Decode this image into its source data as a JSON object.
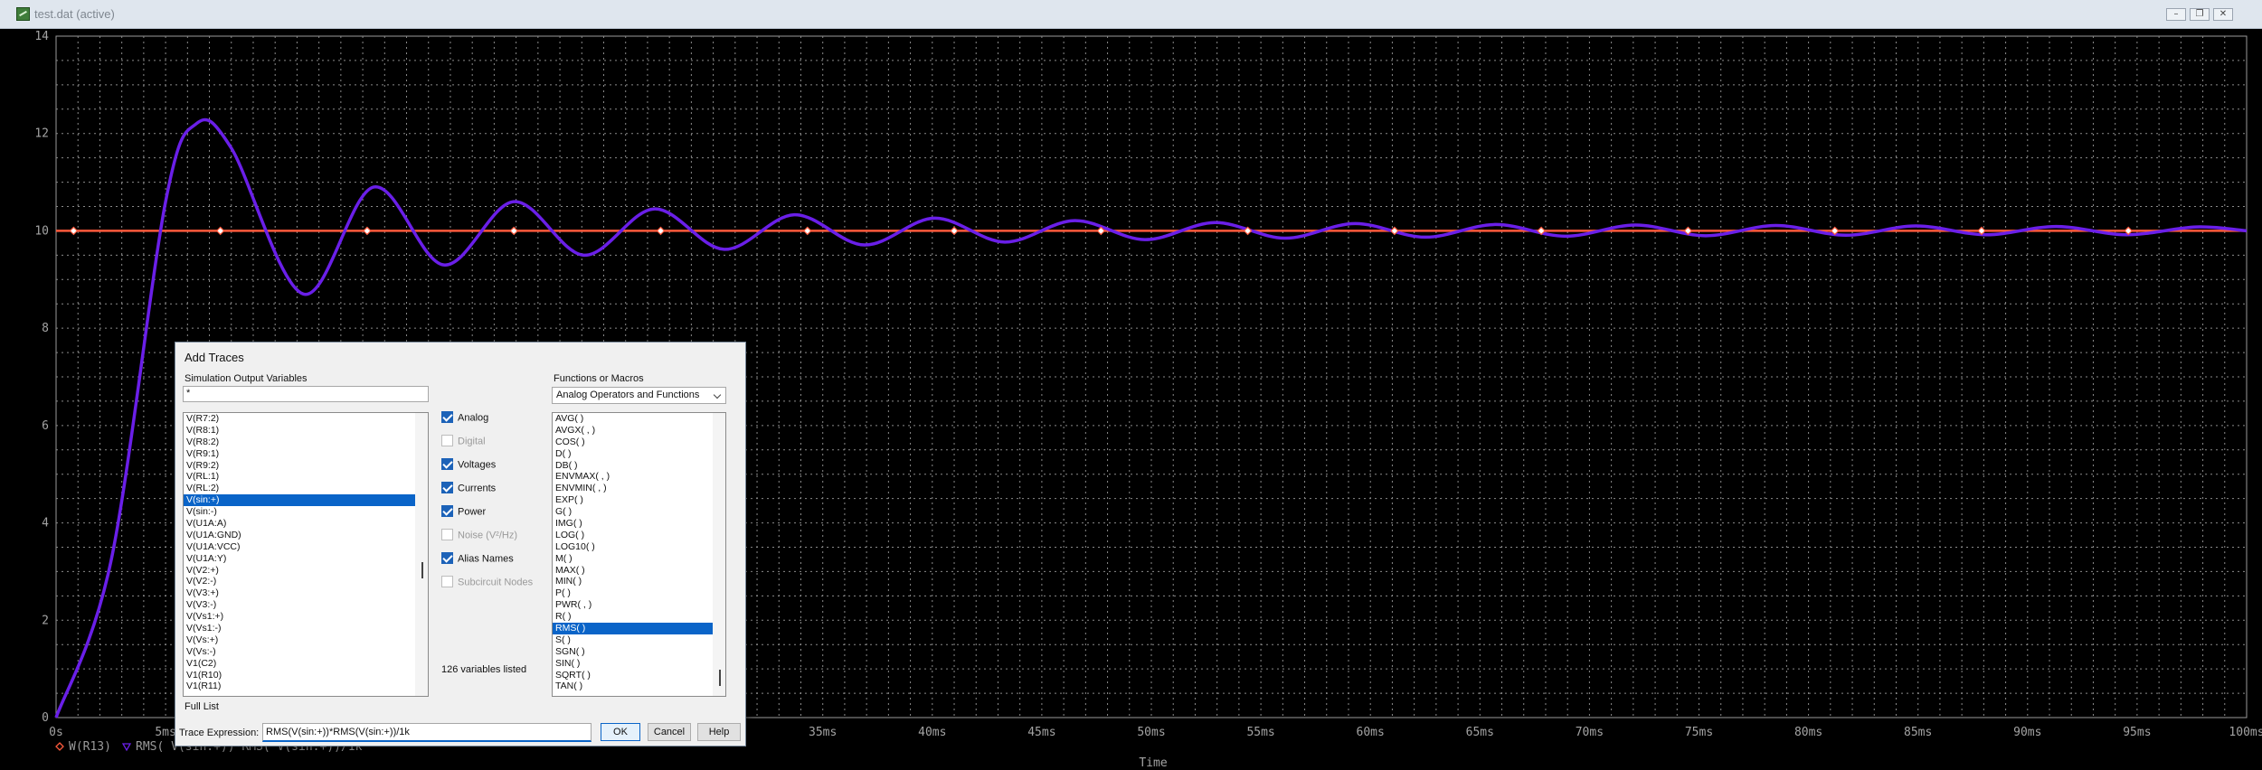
{
  "window": {
    "title": "test.dat (active)",
    "minimize_glyph": "–",
    "restore_glyph": "❐",
    "close_glyph": "✕",
    "icon": "waveform-app-icon"
  },
  "chart_data": {
    "type": "line",
    "title": "",
    "xlabel": "Time",
    "ylabel": "",
    "xlim": [
      0,
      100
    ],
    "ylim": [
      0,
      14
    ],
    "x_unit": "ms",
    "x_ticks": [
      "0s",
      "5ms",
      "10ms",
      "15ms",
      "20ms",
      "25ms",
      "30ms",
      "35ms",
      "40ms",
      "45ms",
      "50ms",
      "55ms",
      "60ms",
      "65ms",
      "70ms",
      "75ms",
      "80ms",
      "85ms",
      "90ms",
      "95ms",
      "100ms"
    ],
    "y_ticks": [
      "0",
      "2",
      "4",
      "6",
      "8",
      "10",
      "12",
      "14"
    ],
    "grid": true,
    "legend_placement": "bottom-left",
    "series": [
      {
        "name": "W(R13)",
        "color": "#ff5a3c",
        "marker": "diamond",
        "x": [
          0,
          100
        ],
        "values": [
          10,
          10
        ]
      },
      {
        "name": "RMS( V(sin:+))*RMS( V(sin:+))/1k",
        "color": "#6a1fe8",
        "marker": "triangle",
        "x": [
          0,
          2.5,
          5,
          6.4,
          8,
          11.3,
          14.5,
          17.7,
          20.9,
          24.1,
          27.3,
          30.5,
          33.7,
          36.9,
          40.1,
          43.3,
          46.5,
          49.7,
          52.9,
          56.1,
          59.3,
          62.5,
          65.7,
          68.9,
          72.1,
          75.3,
          78.5,
          81.7,
          84.9,
          88.1,
          91.3,
          94.5,
          97.7,
          100
        ],
        "values": [
          0,
          3.2,
          10.6,
          12.2,
          11.7,
          8.7,
          10.9,
          9.3,
          10.6,
          9.5,
          10.45,
          9.62,
          10.33,
          9.71,
          10.26,
          9.77,
          10.21,
          9.82,
          10.17,
          9.85,
          10.15,
          9.87,
          10.13,
          9.89,
          10.12,
          9.9,
          10.11,
          9.91,
          10.1,
          9.92,
          10.09,
          9.92,
          10.08,
          10.0
        ]
      }
    ]
  },
  "dialog": {
    "title": "Add Traces",
    "sim_vars_label": "Simulation Output Variables",
    "filter_value": "*",
    "variables": [
      "V(R7:2)",
      "V(R8:1)",
      "V(R8:2)",
      "V(R9:1)",
      "V(R9:2)",
      "V(RL:1)",
      "V(RL:2)",
      "V(sin:+)",
      "V(sin:-)",
      "V(U1A:A)",
      "V(U1A:GND)",
      "V(U1A:VCC)",
      "V(U1A:Y)",
      "V(V2:+)",
      "V(V2:-)",
      "V(V3:+)",
      "V(V3:-)",
      "V(Vs1:+)",
      "V(Vs1:-)",
      "V(Vs:+)",
      "V(Vs:-)",
      "V1(C2)",
      "V1(R10)",
      "V1(R11)"
    ],
    "selected_variable_index": 7,
    "options": [
      {
        "label": "Analog",
        "checked": true,
        "enabled": true
      },
      {
        "label": "Digital",
        "checked": false,
        "enabled": false
      },
      {
        "label": "Voltages",
        "checked": true,
        "enabled": true
      },
      {
        "label": "Currents",
        "checked": true,
        "enabled": true
      },
      {
        "label": "Power",
        "checked": true,
        "enabled": true
      },
      {
        "label": "Noise (V²/Hz)",
        "checked": false,
        "enabled": false
      },
      {
        "label": "Alias Names",
        "checked": true,
        "enabled": true
      },
      {
        "label": "Subcircuit Nodes",
        "checked": false,
        "enabled": false
      }
    ],
    "variables_count": "126 variables listed",
    "full_list_label": "Full List",
    "functions_label": "Functions or Macros",
    "functions_dropdown": "Analog Operators and Functions",
    "functions": [
      "AVG( )",
      "AVGX( , )",
      "COS( )",
      "D( )",
      "DB( )",
      "ENVMAX( , )",
      "ENVMIN( , )",
      "EXP( )",
      "G( )",
      "IMG( )",
      "LOG( )",
      "LOG10( )",
      "M( )",
      "MAX( )",
      "MIN( )",
      "P( )",
      "PWR( , )",
      "R( )",
      "RMS( )",
      "S( )",
      "SGN( )",
      "SIN( )",
      "SQRT( )",
      "TAN( )"
    ],
    "selected_function_index": 18,
    "trace_expression_label": "Trace Expression:",
    "trace_expression_value": "RMS(V(sin:+))*RMS(V(sin:+))/1k",
    "ok_label": "OK",
    "cancel_label": "Cancel",
    "help_label": "Help"
  }
}
